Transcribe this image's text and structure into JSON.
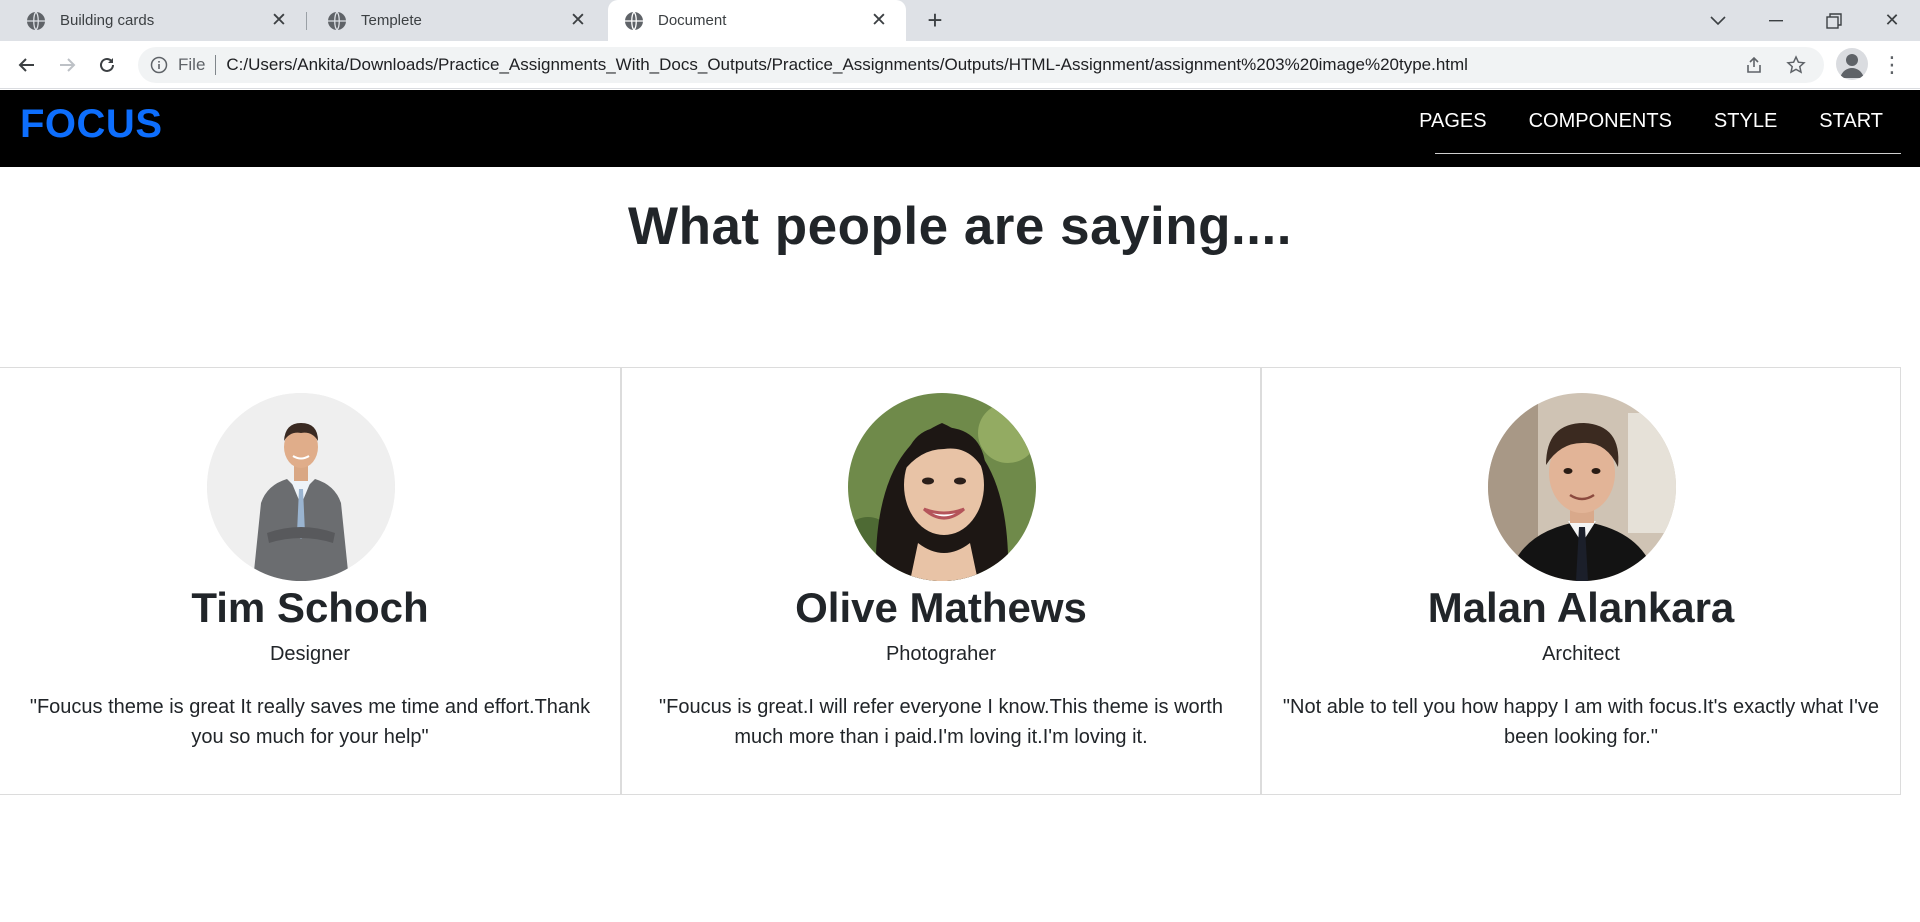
{
  "browser": {
    "tabs": [
      {
        "title": "Building cards",
        "active": false
      },
      {
        "title": "Templete",
        "active": false
      },
      {
        "title": "Document",
        "active": true
      }
    ],
    "address": {
      "scheme": "File",
      "url": "C:/Users/Ankita/Downloads/Practice_Assignments_With_Docs_Outputs/Practice_Assignments/Outputs/HTML-Assignment/assignment%203%20image%20type.html"
    }
  },
  "navbar": {
    "brand": "FOCUS",
    "brand_color": "#0d6efd",
    "links": [
      "PAGES",
      "COMPONENTS",
      "STYLE",
      "START"
    ]
  },
  "heading": "What people are saying....",
  "testimonials": [
    {
      "name": "Tim Schoch",
      "role": "Designer",
      "quote": "\"Foucus theme is great It really saves me time and effort.Thank you so much for your help\""
    },
    {
      "name": "Olive Mathews",
      "role": "Photograher",
      "quote": "\"Foucus is great.I will refer everyone I know.This theme is worth much more than i paid.I'm loving it.I'm loving it."
    },
    {
      "name": "Malan Alankara",
      "role": "Architect",
      "quote": "\"Not able to tell you how happy I am with focus.It's exactly what I've been looking for.\""
    }
  ]
}
